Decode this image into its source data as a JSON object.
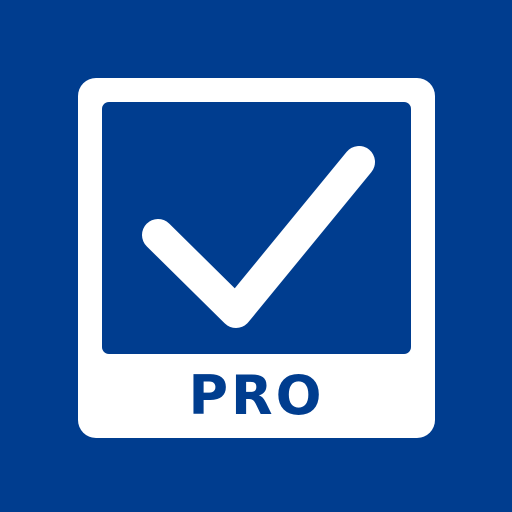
{
  "app_icon": {
    "badge_text": "PRO",
    "icon": "checkmark-icon",
    "colors": {
      "background": "#003d8f",
      "frame": "#ffffff",
      "accent": "#003d8f"
    }
  }
}
